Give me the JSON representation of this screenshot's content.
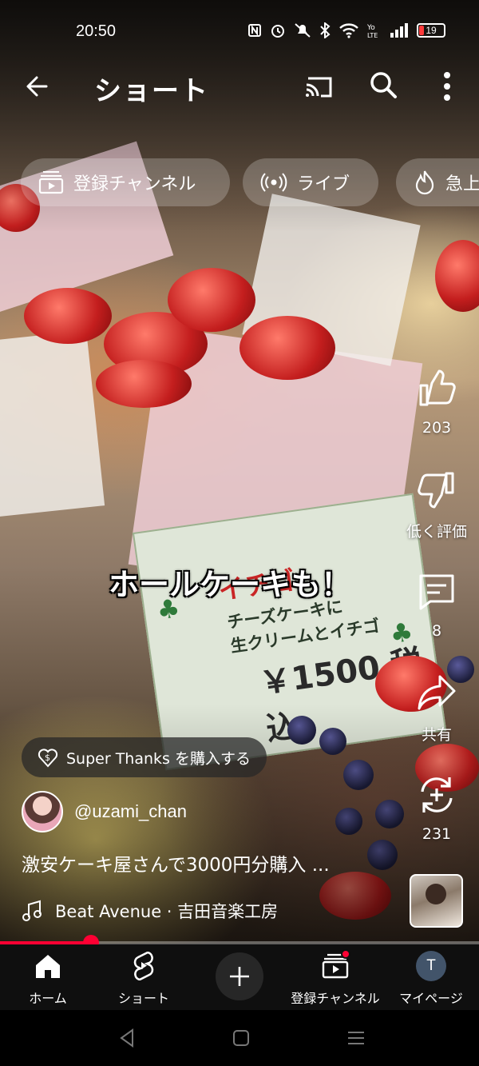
{
  "status_bar": {
    "time": "20:50",
    "battery_level": "19",
    "icons": [
      "nfc-icon",
      "alarm-icon",
      "mute-icon",
      "bluetooth-icon",
      "wifi-icon",
      "volte-icon",
      "signal-icon",
      "battery-icon"
    ]
  },
  "top_bar": {
    "title": "ショート",
    "icons": [
      "back-arrow-icon",
      "cast-icon",
      "search-icon",
      "more-vert-icon"
    ]
  },
  "chips": [
    {
      "label": "登録チャンネル",
      "icon": "subscriptions-icon"
    },
    {
      "label": "ライブ",
      "icon": "live-icon"
    },
    {
      "label": "急上",
      "icon": "trending-icon"
    }
  ],
  "video": {
    "caption": "ホールケーキも！",
    "sign_title": "イチゴ",
    "sign_line1": "チーズケーキに",
    "sign_line2": "生クリームとイチゴ",
    "sign_price": "￥1500 税込"
  },
  "actions": {
    "like_count": "203",
    "dislike_label": "低く評価",
    "comment_count": "8",
    "share_label": "共有",
    "remix_count": "231"
  },
  "meta": {
    "super_thanks_label": "Super Thanks を購入する",
    "channel_handle": "@uzami_chan",
    "video_title": "激安ケーキ屋さんで3000円分購入 ...",
    "music": "Beat Avenue · 吉田音楽工房"
  },
  "progress": {
    "fraction": 0.19
  },
  "bottom_nav": {
    "home_label": "ホーム",
    "shorts_label": "ショート",
    "subscriptions_label": "登録チャンネル",
    "you_label": "マイページ",
    "profile_initial": "T"
  },
  "colors": {
    "accent": "#ff0033",
    "nav_background": "#0f0f0f",
    "chip_background": "rgba(255,255,255,0.22)"
  }
}
